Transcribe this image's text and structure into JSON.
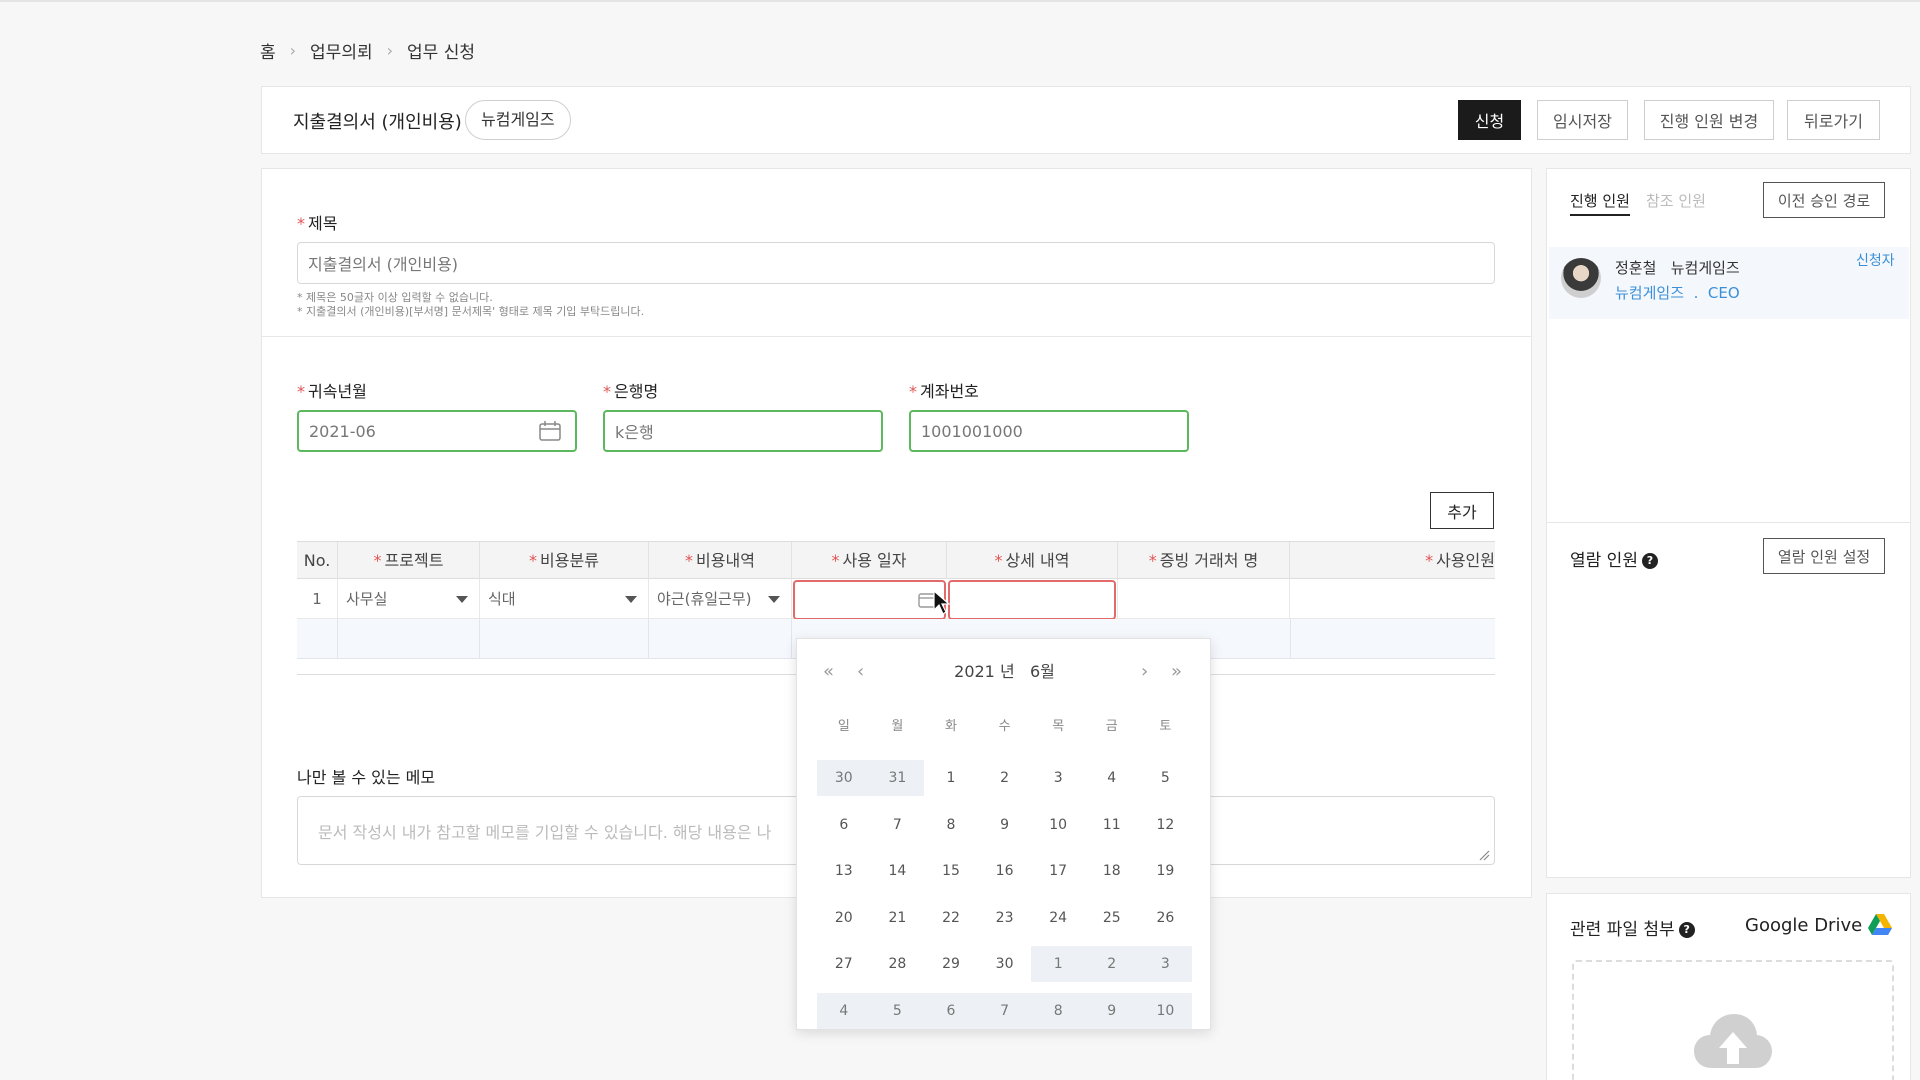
{
  "breadcrumb": {
    "items": [
      "홈",
      "업무의뢰",
      "업무 신청"
    ]
  },
  "header": {
    "doc_title": "지출결의서 (개인비용)",
    "company_chip": "뉴컴게임즈",
    "buttons": {
      "submit": "신청",
      "draft": "임시저장",
      "change_approvers": "진행 인원 변경",
      "back": "뒤로가기"
    }
  },
  "form": {
    "title_label": "제목",
    "title_value": "지출결의서 (개인비용)",
    "hints": [
      "* 제목은 50글자 이상 입력할 수 없습니다.",
      "* 지출결의서 (개인비용)[부서명] 문서제목' 형태로 제목 기입 부탁드립니다."
    ],
    "period_label": "귀속년월",
    "period_value": "2021-06",
    "bank_label": "은행명",
    "bank_value": "k은행",
    "account_label": "계좌번호",
    "account_value": "1001001000",
    "add_button": "추가"
  },
  "table": {
    "headers": [
      "No.",
      "프로젝트",
      "비용분류",
      "비용내역",
      "사용 일자",
      "상세 내역",
      "증빙 거래처 명",
      "사용인원"
    ],
    "row": {
      "no": "1",
      "project": "사무실",
      "category": "식대",
      "detail": "야근(휴일근무)"
    }
  },
  "memo": {
    "label": "나만 볼 수 있는 메모",
    "placeholder": "문서 작성시 내가 참고할 메모를 기입할 수 있습니다. 해당 내용은 나"
  },
  "datepicker": {
    "year": "2021 년",
    "month": "6월",
    "nav": {
      "prev_year": "«",
      "prev_month": "‹",
      "next_month": "›",
      "next_year": "»"
    },
    "weekdays": [
      "일",
      "월",
      "화",
      "수",
      "목",
      "금",
      "토"
    ],
    "days": [
      [
        "30",
        "31",
        "1",
        "2",
        "3",
        "4",
        "5"
      ],
      [
        "6",
        "7",
        "8",
        "9",
        "10",
        "11",
        "12"
      ],
      [
        "13",
        "14",
        "15",
        "16",
        "17",
        "18",
        "19"
      ],
      [
        "20",
        "21",
        "22",
        "23",
        "24",
        "25",
        "26"
      ],
      [
        "27",
        "28",
        "29",
        "30",
        "1",
        "2",
        "3"
      ],
      [
        "4",
        "5",
        "6",
        "7",
        "8",
        "9",
        "10"
      ]
    ]
  },
  "approvers": {
    "tab_active": "진행 인원",
    "tab_inactive": "참조 인원",
    "prev_route_button": "이전 승인 경로",
    "person": {
      "name": "정훈철",
      "company": "뉴컴게임즈",
      "dept": "뉴컴게임즈",
      "dot": ".",
      "role": "CEO",
      "badge": "신청자"
    }
  },
  "viewers": {
    "title": "열람 인원",
    "settings_button": "열람 인원 설정"
  },
  "attachments": {
    "title": "관련 파일 첨부",
    "drive_label": "Google Drive"
  },
  "colors": {
    "accent_green": "#5cb85c",
    "error_red": "#e36a6a",
    "link_blue": "#3b8fd9",
    "primary_button": "#1b1b1b"
  }
}
